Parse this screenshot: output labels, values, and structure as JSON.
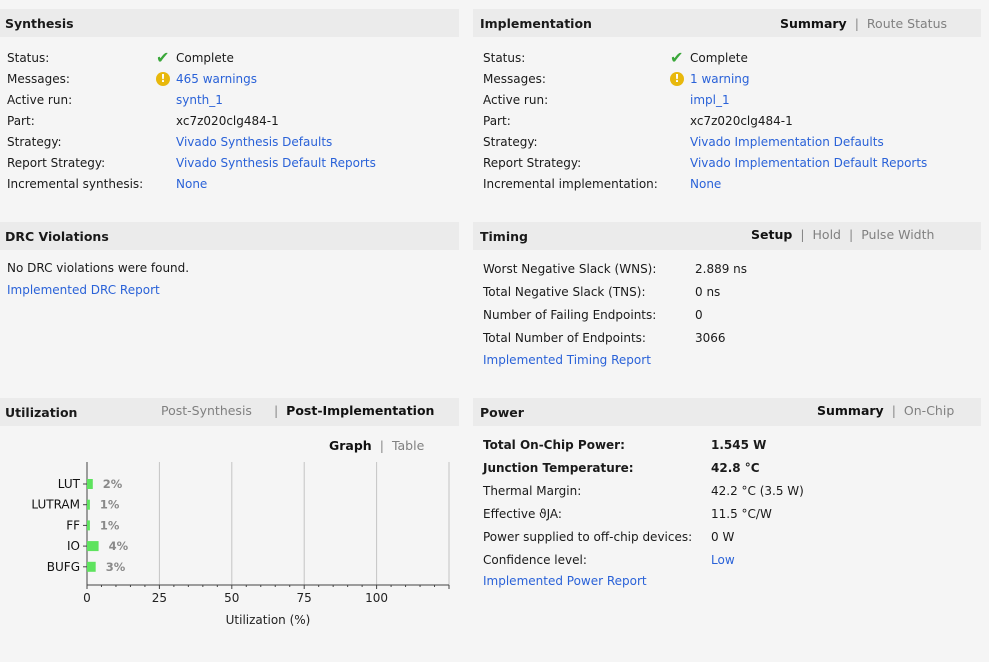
{
  "synthesis": {
    "title": "Synthesis",
    "rows": [
      {
        "label": "Status:",
        "value": "Complete",
        "link": false,
        "icon": "check-icon"
      },
      {
        "label": "Messages:",
        "value": "465 warnings",
        "link": true,
        "icon": "warning-icon"
      },
      {
        "label": "Active run:",
        "value": "synth_1",
        "link": true
      },
      {
        "label": "Part:",
        "value": "xc7z020clg484-1",
        "link": false
      },
      {
        "label": "Strategy:",
        "value": "Vivado Synthesis Defaults",
        "link": true
      },
      {
        "label": "Report Strategy:",
        "value": "Vivado Synthesis Default Reports",
        "link": true
      },
      {
        "label": "Incremental synthesis:",
        "value": "None",
        "link": true
      }
    ]
  },
  "implementation": {
    "title": "Implementation",
    "tabs": [
      "Summary",
      "Route Status"
    ],
    "active_tab": "Summary",
    "rows": [
      {
        "label": "Status:",
        "value": "Complete",
        "link": false,
        "icon": "check-icon"
      },
      {
        "label": "Messages:",
        "value": "1 warning",
        "link": true,
        "icon": "warning-icon"
      },
      {
        "label": "Active run:",
        "value": "impl_1",
        "link": true
      },
      {
        "label": "Part:",
        "value": "xc7z020clg484-1",
        "link": false
      },
      {
        "label": "Strategy:",
        "value": "Vivado Implementation Defaults",
        "link": true
      },
      {
        "label": "Report Strategy:",
        "value": "Vivado Implementation Default Reports",
        "link": true
      },
      {
        "label": "Incremental implementation:",
        "value": "None",
        "link": true
      }
    ]
  },
  "drc": {
    "title": "DRC Violations",
    "message": "No DRC violations were found.",
    "report_link": "Implemented DRC Report"
  },
  "timing": {
    "title": "Timing",
    "tabs": [
      "Setup",
      "Hold",
      "Pulse Width"
    ],
    "active_tab": "Setup",
    "rows": [
      {
        "label": "Worst Negative Slack (WNS):",
        "value": "2.889 ns"
      },
      {
        "label": "Total Negative Slack (TNS):",
        "value": "0 ns"
      },
      {
        "label": "Number of Failing Endpoints:",
        "value": "0"
      },
      {
        "label": "Total Number of Endpoints:",
        "value": "3066"
      }
    ],
    "report_link": "Implemented Timing Report"
  },
  "utilization": {
    "title": "Utilization",
    "tabs": [
      "Post-Synthesis",
      "Post-Implementation"
    ],
    "active_tab": "Post-Implementation",
    "view_tabs": [
      "Graph",
      "Table"
    ],
    "active_view": "Graph"
  },
  "power": {
    "title": "Power",
    "tabs": [
      "Summary",
      "On-Chip"
    ],
    "active_tab": "Summary",
    "rows": [
      {
        "label": "Total On-Chip Power:",
        "value": "1.545 W",
        "bold": true
      },
      {
        "label": "Junction Temperature:",
        "value": "42.8 °C",
        "bold": true
      },
      {
        "label": "Thermal Margin:",
        "value": "42.2 °C (3.5 W)"
      },
      {
        "label": "Effective ϑJA:",
        "value": "11.5 °C/W"
      },
      {
        "label": "Power supplied to off-chip devices:",
        "value": "0 W"
      },
      {
        "label": "Confidence level:",
        "value": "Low",
        "link": true
      }
    ],
    "report_link": "Implemented Power Report"
  },
  "colors": {
    "link": "#2a62d8",
    "bar": "#5ee35e",
    "check": "#3aa73a",
    "warning": "#e8b80c"
  },
  "chart_data": {
    "type": "bar",
    "orientation": "horizontal",
    "categories": [
      "LUT",
      "LUTRAM",
      "FF",
      "IO",
      "BUFG"
    ],
    "values": [
      2,
      1,
      1,
      4,
      3
    ],
    "data_labels": [
      "2%",
      "1%",
      "1%",
      "4%",
      "3%"
    ],
    "xlabel": "Utilization (%)",
    "xticks": [
      "0",
      "25",
      "50",
      "75",
      "100"
    ],
    "xlim": [
      0,
      125
    ],
    "grid": true
  }
}
